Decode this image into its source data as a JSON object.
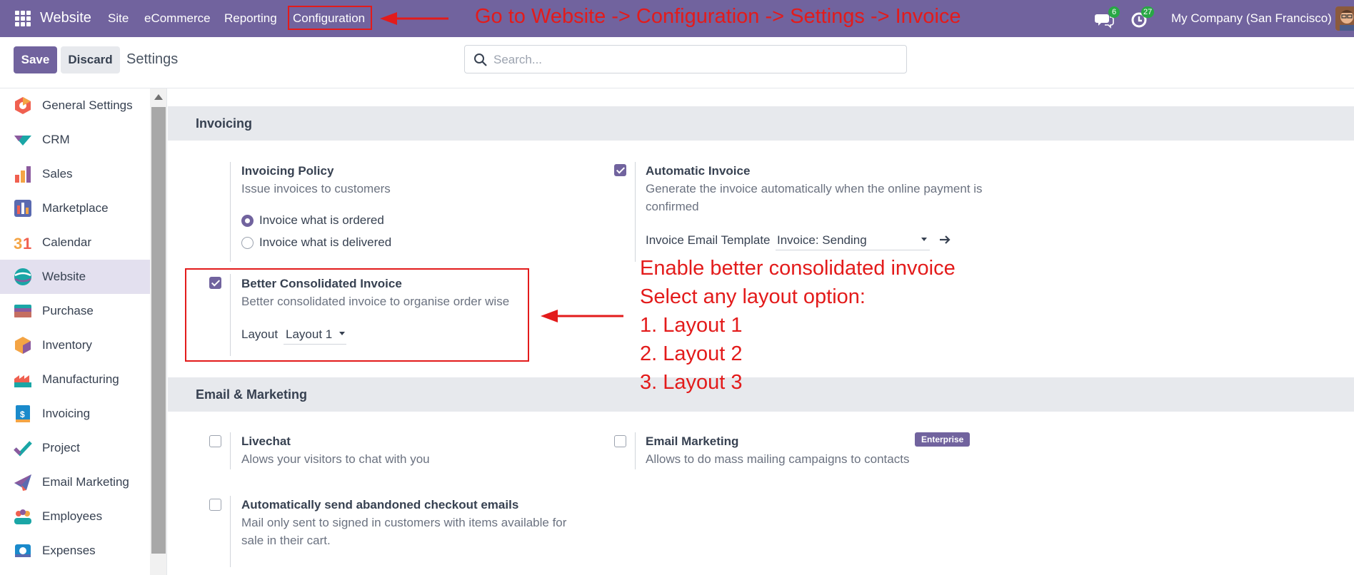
{
  "topbar": {
    "brand": "Website",
    "menu": [
      "Site",
      "eCommerce",
      "Reporting",
      "Configuration"
    ],
    "messages_count": "6",
    "activities_count": "27",
    "company": "My Company (San Francisco)"
  },
  "control": {
    "save_label": "Save",
    "discard_label": "Discard",
    "title": "Settings",
    "search_placeholder": "Search..."
  },
  "sidebar": {
    "items": [
      {
        "label": "General Settings",
        "icon": "general-settings-icon"
      },
      {
        "label": "CRM",
        "icon": "crm-icon"
      },
      {
        "label": "Sales",
        "icon": "sales-icon"
      },
      {
        "label": "Marketplace",
        "icon": "marketplace-icon"
      },
      {
        "label": "Calendar",
        "icon": "calendar-icon"
      },
      {
        "label": "Website",
        "icon": "website-icon"
      },
      {
        "label": "Purchase",
        "icon": "purchase-icon"
      },
      {
        "label": "Inventory",
        "icon": "inventory-icon"
      },
      {
        "label": "Manufacturing",
        "icon": "manufacturing-icon"
      },
      {
        "label": "Invoicing",
        "icon": "invoicing-icon"
      },
      {
        "label": "Project",
        "icon": "project-icon"
      },
      {
        "label": "Email Marketing",
        "icon": "email-marketing-icon"
      },
      {
        "label": "Employees",
        "icon": "employees-icon"
      },
      {
        "label": "Expenses",
        "icon": "expenses-icon"
      }
    ],
    "active": "Website"
  },
  "invoicing": {
    "heading": "Invoicing",
    "policy": {
      "title": "Invoicing Policy",
      "desc": "Issue invoices to customers",
      "options": [
        "Invoice what is ordered",
        "Invoice what is delivered"
      ],
      "selected": "Invoice what is ordered"
    },
    "automatic": {
      "title": "Automatic Invoice",
      "desc_line1": "Generate the invoice automatically when the online payment is",
      "desc_line2": "confirmed",
      "checked": true,
      "template_label": "Invoice Email Template",
      "template_value": "Invoice: Sending"
    },
    "consolidated": {
      "title": "Better Consolidated Invoice",
      "desc": "Better consolidated invoice to organise order wise",
      "checked": true,
      "layout_label": "Layout",
      "layout_value": "Layout 1"
    }
  },
  "email_marketing": {
    "heading": "Email & Marketing",
    "livechat": {
      "title": "Livechat",
      "desc": "Alows your visitors to chat with you",
      "checked": false
    },
    "email_marketing": {
      "title": "Email Marketing",
      "desc": "Allows to do mass mailing campaigns to contacts",
      "checked": false,
      "badge": "Enterprise"
    },
    "abandoned": {
      "title": "Automatically send abandoned checkout emails",
      "desc_line1": "Mail only sent to signed in customers with items available for",
      "desc_line2": "sale in their cart.",
      "checked": false
    }
  },
  "annotations": {
    "top": "Go to Website -> Configuration -> Settings -> Invoice",
    "lines": [
      "Enable better consolidated invoice",
      "Select any layout option:",
      "1. Layout 1",
      "2. Layout 2",
      "3. Layout 3"
    ]
  },
  "colors": {
    "brand": "#71639e",
    "annotation": "#e31b1b",
    "badge": "#28a745"
  }
}
